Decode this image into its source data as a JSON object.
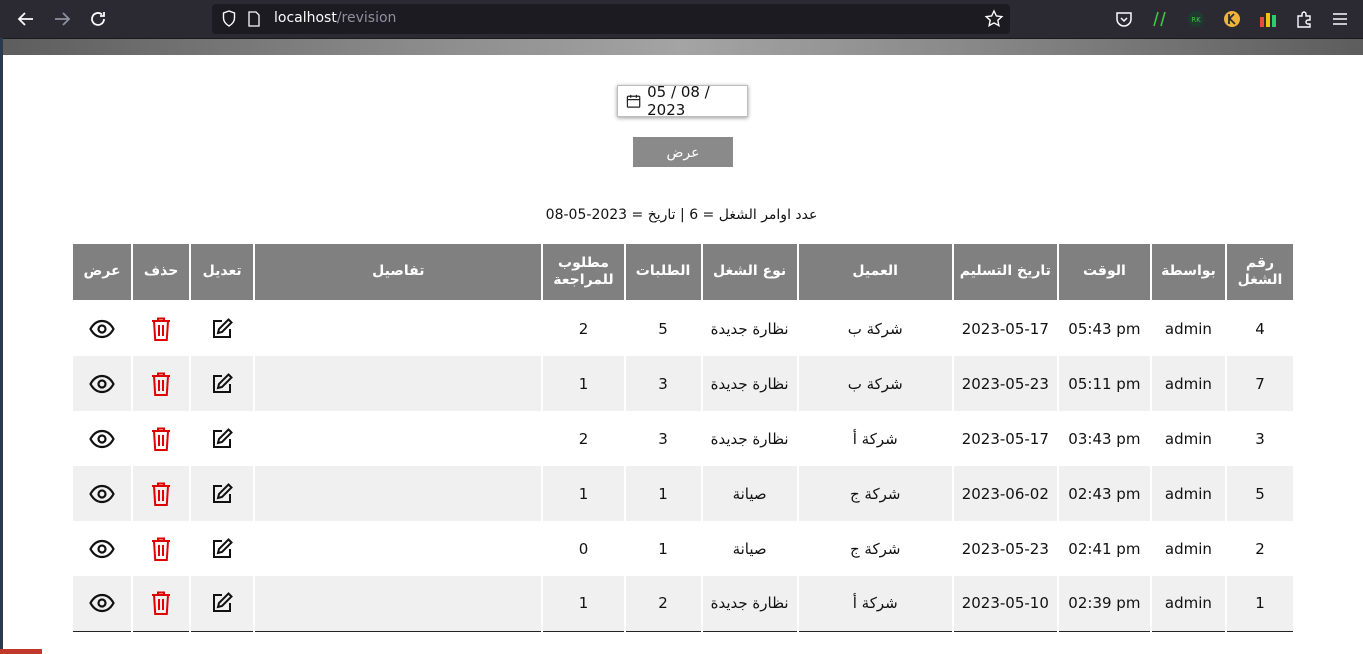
{
  "browser": {
    "url_host": "localhost",
    "url_path": "/revision"
  },
  "filter": {
    "date_value": "05 / 08 / 2023",
    "show_button_label": "عرض"
  },
  "summary": {
    "text": "عدد اوامر الشغل = 6 | تاريخ = 2023-05-08"
  },
  "table": {
    "headers": {
      "job_no": "رقم الشغل",
      "by": "بواسطة",
      "time": "الوقت",
      "delivery_date": "تاريخ التسليم",
      "client": "العميل",
      "job_type": "نوع الشغل",
      "orders": "الطلبات",
      "review_required": "مطلوب للمراجعة",
      "details": "تفاصيل",
      "edit": "تعديل",
      "delete": "حذف",
      "view": "عرض"
    },
    "rows": [
      {
        "job_no": "4",
        "by": "admin",
        "time": "05:43 pm",
        "delivery_date": "2023-05-17",
        "client": "شركة ب",
        "job_type": "نظارة جديدة",
        "orders": "5",
        "review_required": "2",
        "details": ""
      },
      {
        "job_no": "7",
        "by": "admin",
        "time": "05:11 pm",
        "delivery_date": "2023-05-23",
        "client": "شركة ب",
        "job_type": "نظارة جديدة",
        "orders": "3",
        "review_required": "1",
        "details": ""
      },
      {
        "job_no": "3",
        "by": "admin",
        "time": "03:43 pm",
        "delivery_date": "2023-05-17",
        "client": "شركة أ",
        "job_type": "نظارة جديدة",
        "orders": "3",
        "review_required": "2",
        "details": ""
      },
      {
        "job_no": "5",
        "by": "admin",
        "time": "02:43 pm",
        "delivery_date": "2023-06-02",
        "client": "شركة ج",
        "job_type": "صيانة",
        "orders": "1",
        "review_required": "1",
        "details": ""
      },
      {
        "job_no": "2",
        "by": "admin",
        "time": "02:41 pm",
        "delivery_date": "2023-05-23",
        "client": "شركة ج",
        "job_type": "صيانة",
        "orders": "1",
        "review_required": "0",
        "details": ""
      },
      {
        "job_no": "1",
        "by": "admin",
        "time": "02:39 pm",
        "delivery_date": "2023-05-10",
        "client": "شركة أ",
        "job_type": "نظارة جديدة",
        "orders": "2",
        "review_required": "1",
        "details": ""
      }
    ]
  },
  "colors": {
    "header_bg": "#808080",
    "delete_icon": "#e00000",
    "row_alt_bg": "#f0f0f0",
    "button_bg": "#8a8a8a"
  },
  "icons": {
    "edit": "edit-icon",
    "delete": "trash-icon",
    "view": "eye-icon"
  }
}
